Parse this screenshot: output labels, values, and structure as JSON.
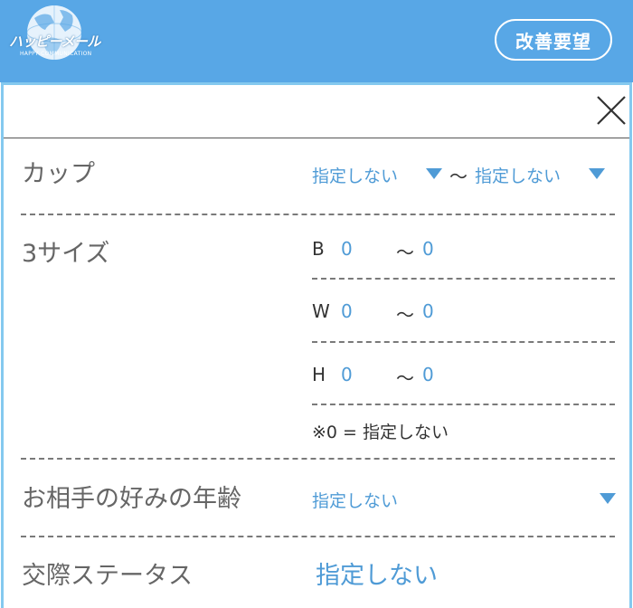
{
  "header": {
    "logo_text": "ハッピーメール",
    "logo_sub": "HAPPY COMMUNICATION",
    "logo_icon": "globe-logo-icon",
    "request_button": "改善要望",
    "background_color": "#58a7e6"
  },
  "panel": {
    "close_icon": "close-icon",
    "border_color": "#84c9ef"
  },
  "cup": {
    "label": "カップ",
    "from": "指定しない",
    "separator": "〜",
    "to": "指定しない"
  },
  "three_size": {
    "label": "3サイズ",
    "rows": [
      {
        "letter": "B",
        "from": "0",
        "separator": "〜",
        "to": "0"
      },
      {
        "letter": "W",
        "from": "0",
        "separator": "〜",
        "to": "0"
      },
      {
        "letter": "H",
        "from": "0",
        "separator": "〜",
        "to": "0"
      }
    ],
    "note": "※0 = 指定しない"
  },
  "preferred_age": {
    "label": "お相手の好みの年齢",
    "value": "指定しない"
  },
  "relationship_status": {
    "label": "交際ステータス",
    "value": "指定しない"
  },
  "colors": {
    "accent_blue": "#4f9bd6",
    "label_gray": "#666666"
  }
}
